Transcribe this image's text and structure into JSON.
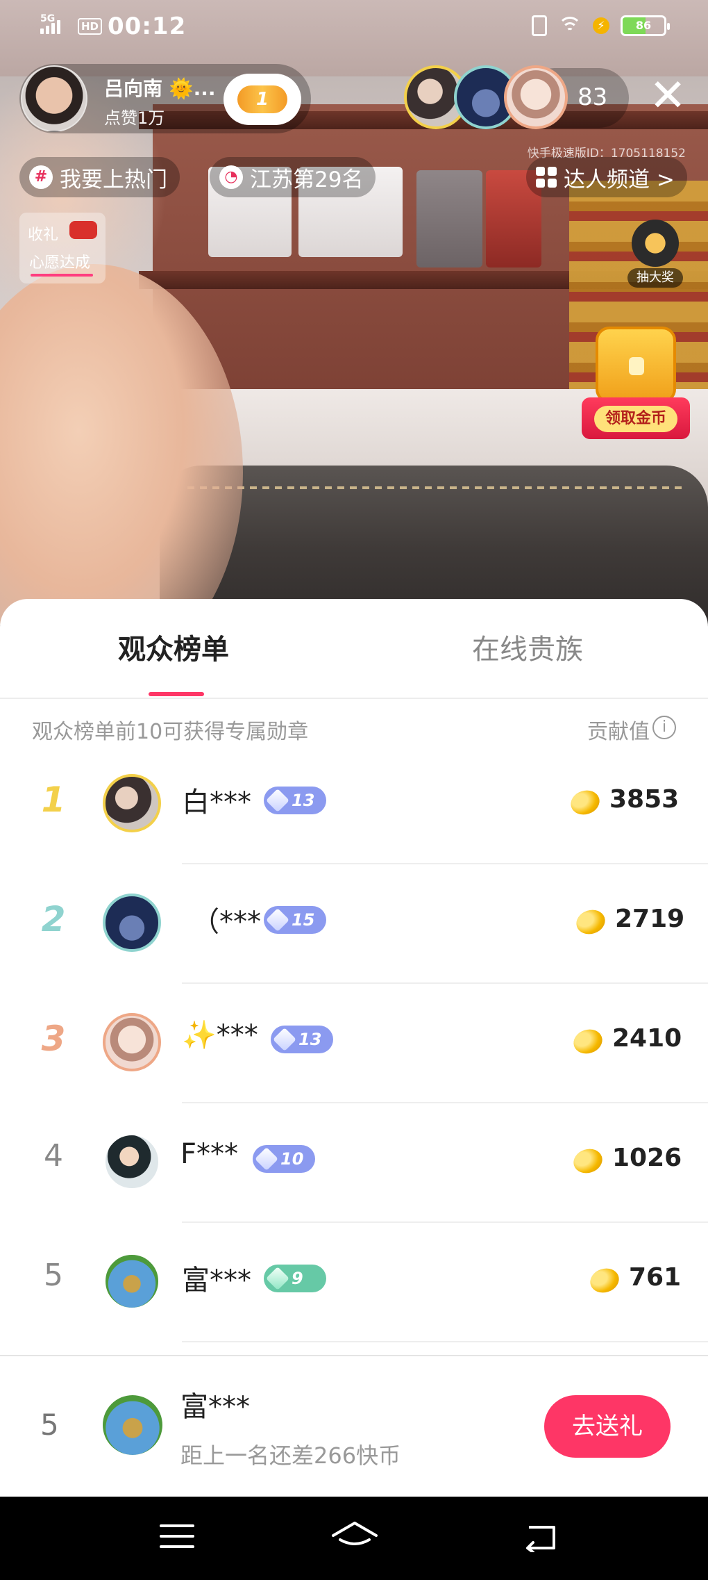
{
  "status_bar": {
    "network": "5G",
    "hd": "HD",
    "time": "00:12",
    "battery": "86"
  },
  "anchor": {
    "name": "吕向南 🌞...",
    "likes": "点赞1万",
    "follow_badge": "1"
  },
  "viewers": {
    "count": "83"
  },
  "room_id": "快手极速版ID：1705118152",
  "chips": {
    "hot": "我要上热门",
    "rank": "江苏第29名",
    "channel": "达人频道 >"
  },
  "wish": {
    "top": "收礼",
    "bottom": "心愿达成"
  },
  "lottery": {
    "label": "抽大奖"
  },
  "coin_chest": {
    "label": "领取金币"
  },
  "sheet": {
    "tabs": [
      {
        "label": "观众榜单"
      },
      {
        "label": "在线贵族"
      }
    ],
    "hint": "观众榜单前10可获得专属勋章",
    "contribution_label": "贡献值",
    "rows": [
      {
        "rank": "1",
        "nick": "白***",
        "level": "13",
        "score": "3853"
      },
      {
        "rank": "2",
        "nick": "（***",
        "level": "15",
        "score": "2719"
      },
      {
        "rank": "3",
        "nick": "✨***",
        "level": "13",
        "score": "2410"
      },
      {
        "rank": "4",
        "nick": "F***",
        "level": "10",
        "score": "1026"
      },
      {
        "rank": "5",
        "nick": "富***",
        "level": "9",
        "score": "761"
      }
    ],
    "me": {
      "rank": "5",
      "nick": "富***",
      "gap": "距上一名还差266快币",
      "gift_button": "去送礼"
    }
  },
  "colors": {
    "accent": "#fe3666",
    "rank1": "#f3d04a",
    "rank2": "#8fd3cf",
    "rank3": "#eea786",
    "level_blue": "#8b9af0",
    "level_green": "#66c9a6"
  }
}
